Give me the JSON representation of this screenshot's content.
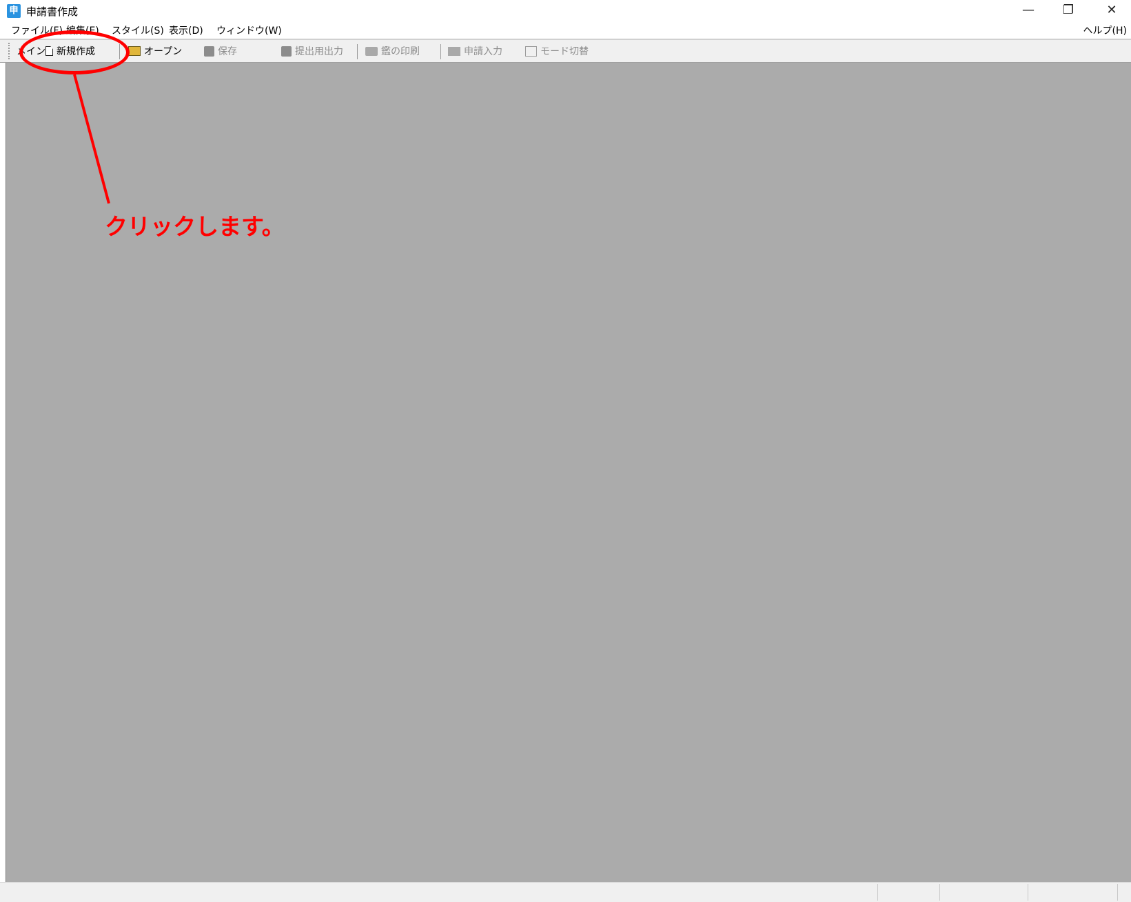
{
  "window": {
    "title": "申請書作成",
    "app_icon_glyph": "申",
    "controls": {
      "minimize": "—",
      "restore": "❐",
      "close": "✕"
    }
  },
  "menu": {
    "items": [
      "ファイル(F)",
      "編集(E)",
      "スタイル(S)",
      "表示(D)",
      "ウィンドウ(W)"
    ],
    "help": "ヘルプ(H)"
  },
  "toolbar": {
    "label": "メイン",
    "new": "新規作成",
    "open": "オープン",
    "save": "保存",
    "submit_output": "提出用出力",
    "print": "鑑の印刷",
    "application_input": "申請入力",
    "mode_switch": "モード切替"
  },
  "annotation": {
    "text": "クリックします。",
    "color": "#ff0000"
  },
  "colors": {
    "workspace": "#ababab",
    "toolbar_bg": "#f0f0f0",
    "app_icon": "#2a93e0"
  }
}
